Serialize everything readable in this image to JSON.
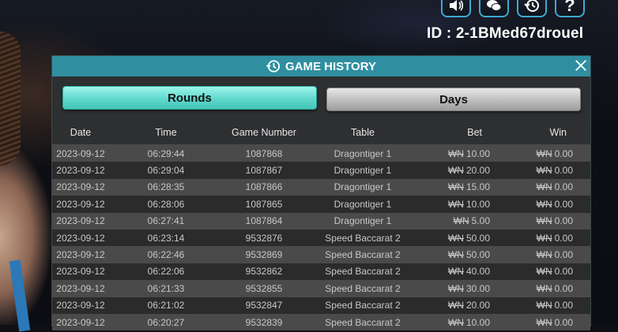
{
  "top_bar": {
    "help_label": "?",
    "user_id": "ID : 2-1BMed67drouel"
  },
  "panel": {
    "title": "GAME HISTORY",
    "tabs": {
      "rounds": "Rounds",
      "days": "Days"
    }
  },
  "table": {
    "headers": {
      "date": "Date",
      "time": "Time",
      "game_number": "Game Number",
      "table": "Table",
      "bet": "Bet",
      "win": "Win"
    },
    "currency_symbol": "₩N",
    "rows": [
      {
        "date": "2023-09-12",
        "time": "06:29:44",
        "game_number": "1087868",
        "table": "Dragontiger 1",
        "bet": "10.00",
        "win": "0.00"
      },
      {
        "date": "2023-09-12",
        "time": "06:29:04",
        "game_number": "1087867",
        "table": "Dragontiger 1",
        "bet": "20.00",
        "win": "0.00"
      },
      {
        "date": "2023-09-12",
        "time": "06:28:35",
        "game_number": "1087866",
        "table": "Dragontiger 1",
        "bet": "15.00",
        "win": "0.00"
      },
      {
        "date": "2023-09-12",
        "time": "06:28:06",
        "game_number": "1087865",
        "table": "Dragontiger 1",
        "bet": "10.00",
        "win": "0.00"
      },
      {
        "date": "2023-09-12",
        "time": "06:27:41",
        "game_number": "1087864",
        "table": "Dragontiger 1",
        "bet": "5.00",
        "win": "0.00"
      },
      {
        "date": "2023-09-12",
        "time": "06:23:14",
        "game_number": "9532876",
        "table": "Speed Baccarat 2",
        "bet": "50.00",
        "win": "0.00"
      },
      {
        "date": "2023-09-12",
        "time": "06:22:46",
        "game_number": "9532869",
        "table": "Speed Baccarat 2",
        "bet": "50.00",
        "win": "0.00"
      },
      {
        "date": "2023-09-12",
        "time": "06:22:06",
        "game_number": "9532862",
        "table": "Speed Baccarat 2",
        "bet": "40.00",
        "win": "0.00"
      },
      {
        "date": "2023-09-12",
        "time": "06:21:33",
        "game_number": "9532855",
        "table": "Speed Baccarat 2",
        "bet": "30.00",
        "win": "0.00"
      },
      {
        "date": "2023-09-12",
        "time": "06:21:02",
        "game_number": "9532847",
        "table": "Speed Baccarat 2",
        "bet": "20.00",
        "win": "0.00"
      },
      {
        "date": "2023-09-12",
        "time": "06:20:27",
        "game_number": "9532839",
        "table": "Speed Baccarat 2",
        "bet": "10.00",
        "win": "0.00"
      }
    ]
  },
  "colors": {
    "header_teal": "#2f8fa0",
    "active_tab": "#5fd8cc",
    "inactive_tab": "#b9b9b9",
    "row_light": "#4a4a4a",
    "row_dark": "#2b2b2b",
    "icon_border": "#3fa9d1"
  },
  "icons": [
    "speaker-icon",
    "chat-icon",
    "history-icon",
    "help-icon",
    "clock-history-icon",
    "close-icon"
  ]
}
